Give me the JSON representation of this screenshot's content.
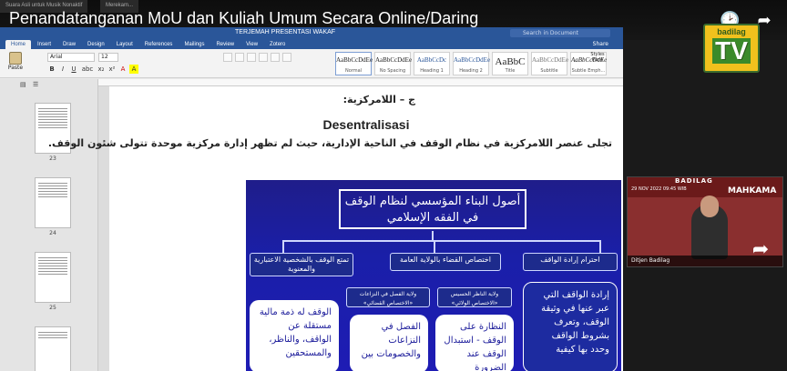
{
  "player": {
    "title": "Penandatanganan MoU dan Kuliah Umum Secara Online/Daring",
    "ghost_tabs": [
      "Suara Asli untuk Musik Nonaktif",
      "Merekam..."
    ],
    "watch_later_icon": "clock-icon",
    "share_icon": "share-arrow-icon",
    "brand_top": "badilag",
    "brand_main": "TV"
  },
  "word": {
    "doc_title": "TERJEMAH PRESENTASI WAKAF",
    "search_placeholder": "Search in Document",
    "share_label": "Share",
    "tabs": [
      "Home",
      "Insert",
      "Draw",
      "Design",
      "Layout",
      "References",
      "Mailings",
      "Review",
      "View",
      "Zotero"
    ],
    "active_tab": "Home",
    "paste_label": "Paste",
    "font_name": "Arial",
    "font_size": "12",
    "format_buttons": [
      "B",
      "I",
      "U",
      "abc",
      "x₂",
      "x²",
      "A",
      "A"
    ],
    "styles": [
      {
        "preview": "AaBbCcDdEe",
        "name": "Normal"
      },
      {
        "preview": "AaBbCcDdEe",
        "name": "No Spacing"
      },
      {
        "preview": "AaBbCcDc",
        "name": "Heading 1"
      },
      {
        "preview": "AaBbCcDdEe",
        "name": "Heading 2"
      },
      {
        "preview": "AaBbC",
        "name": "Title"
      },
      {
        "preview": "AaBbCcDdEe",
        "name": "Subtitle"
      },
      {
        "preview": "AaBbCcDdEe",
        "name": "Subtle Emph..."
      }
    ],
    "styles_pane": "Styles Pane",
    "page_numbers": [
      "23",
      "24",
      "25"
    ],
    "doc_lines": {
      "arabic_heading": "ج – اللامركزية:",
      "latin_heading": "Desentralisasi",
      "arabic_body": "تجلى عنصر اللامركزية في نظام الوقف في الناحية الإدارية، حيث لم تظهر إدارة مركزية موحدة تتولى شئون الوقف."
    },
    "slide": {
      "head": "أصول البناء المؤسسي لنظام الوقف في الفقه الإسلامي",
      "branches": [
        "احترام إرادة الواقف",
        "اختصاص القضاء بالولاية العامة",
        "تمتع الوقف بالشخصية الاعتبارية والمعنوية"
      ],
      "sub_branches": [
        "ولاية الناظر الحسيس «الاختصاص الولائي»",
        "ولاية الفصل في النزاعات «الاختصاص القضائي»"
      ],
      "cards": [
        "إرادة الواقف التي عبر عنها في وثيقة الوقف، وتعرف بشروط الواقف وحدد بها كيفية",
        "النظارة على الوقف - استبدال الوقف عند الضرورة",
        "الفصل في النزاعات والخصومات بين",
        "الوقف له ذمة مالية مستقلة عن الواقف، والناظر، والمستحقين"
      ]
    }
  },
  "webcam": {
    "banner_top": "BADILAG",
    "banner_main": "MAHKAMA",
    "date": "29 NOV 2022 09:45 WIB",
    "name_label": "Ditjen Badilag"
  },
  "colors": {
    "word_blue": "#2a5699",
    "slide_blue": "#1e1cb4",
    "brand_yellow": "#f1c11d"
  }
}
